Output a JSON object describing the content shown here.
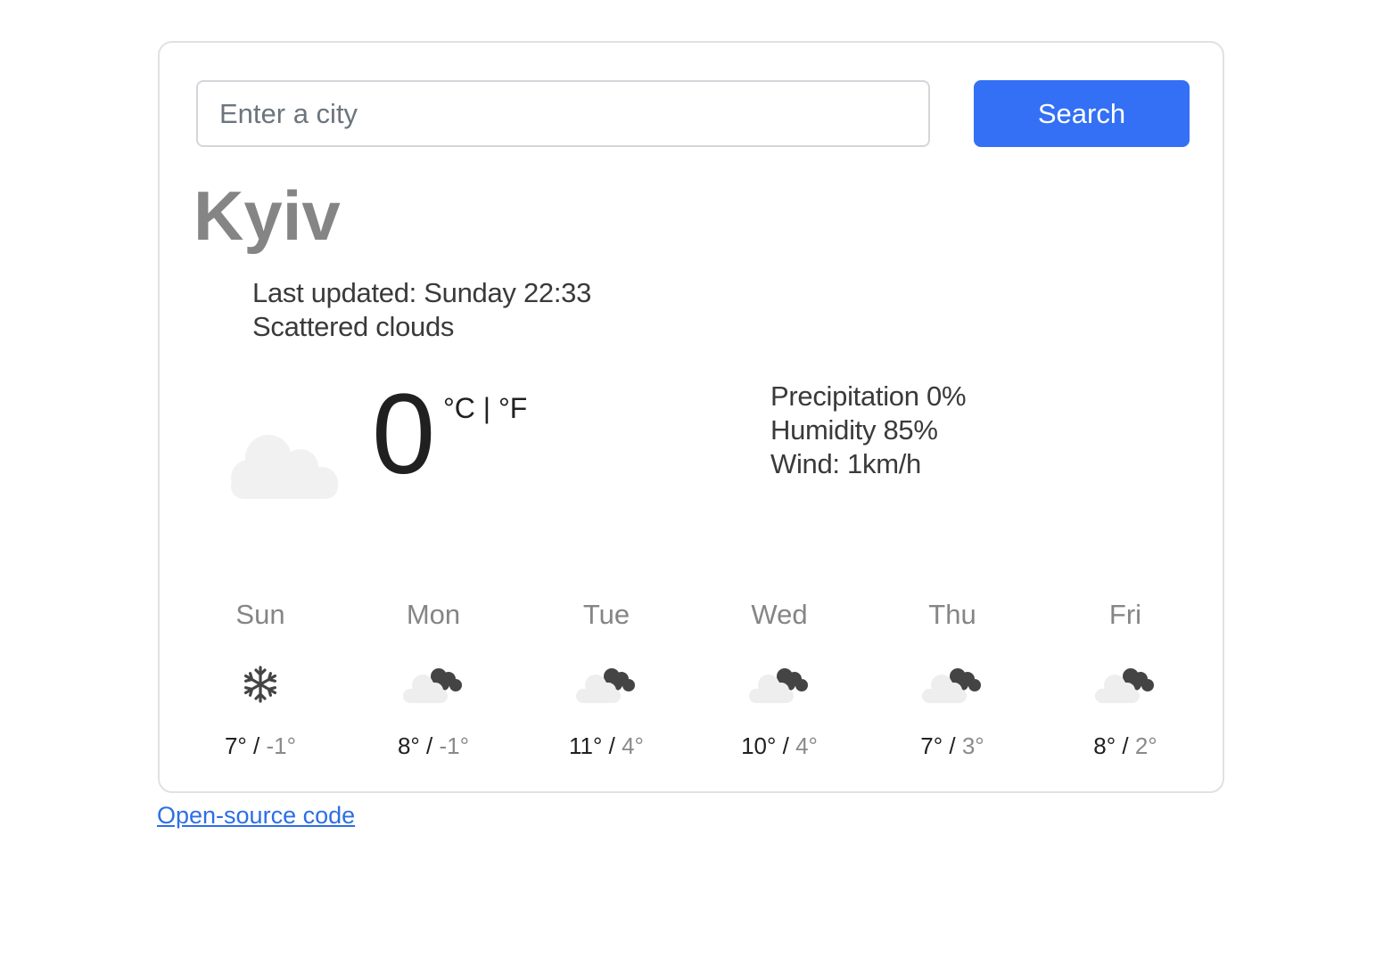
{
  "search": {
    "placeholder": "Enter a city",
    "value": "",
    "button_label": "Search"
  },
  "current": {
    "city": "Kyiv",
    "last_updated": "Last updated: Sunday 22:33",
    "description": "Scattered clouds",
    "icon": "cloud-icon",
    "temperature": "0",
    "unit_celsius": "°C",
    "unit_separator": " | ",
    "unit_fahrenheit": "°F",
    "precipitation": "Precipitation 0%",
    "humidity": "Humidity 85%",
    "wind": "Wind: 1km/h"
  },
  "forecast": [
    {
      "day": "Sun",
      "icon": "snowflake-icon",
      "max": "7°",
      "min": "-1°"
    },
    {
      "day": "Mon",
      "icon": "cloudy-icon",
      "max": "8°",
      "min": "-1°"
    },
    {
      "day": "Tue",
      "icon": "cloudy-icon",
      "max": "11°",
      "min": "4°"
    },
    {
      "day": "Wed",
      "icon": "cloudy-icon",
      "max": "10°",
      "min": "4°"
    },
    {
      "day": "Thu",
      "icon": "cloudy-icon",
      "max": "7°",
      "min": "3°"
    },
    {
      "day": "Fri",
      "icon": "cloudy-icon",
      "max": "8°",
      "min": "2°"
    }
  ],
  "footer": {
    "link_label": "Open-source code"
  },
  "colors": {
    "accent": "#3370f5",
    "link": "#2d6ee5",
    "muted": "#858585"
  }
}
